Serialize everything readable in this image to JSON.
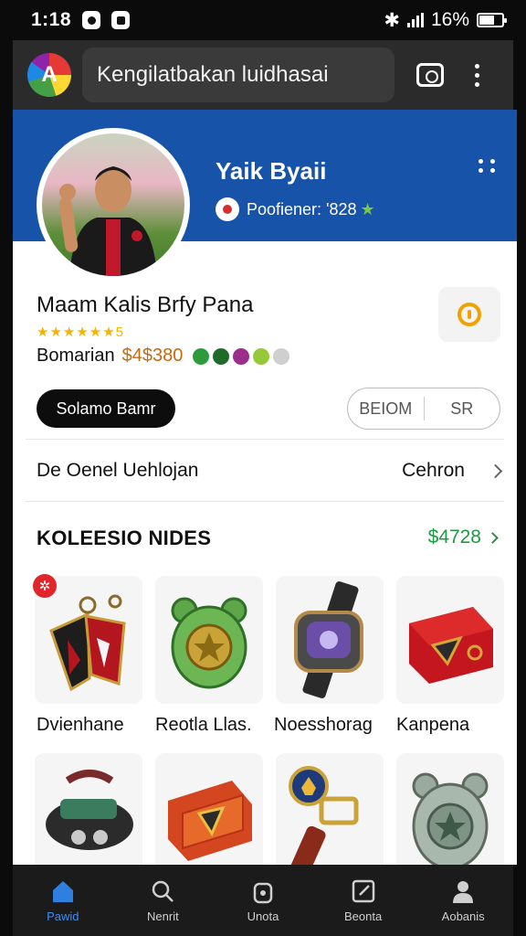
{
  "status_bar": {
    "time": "1:18",
    "battery": "16%"
  },
  "app_bar": {
    "logo_letter": "A",
    "search_text": "Kengilatbakan luidhasai"
  },
  "profile": {
    "name": "Yaik Byaii",
    "badge_text": "Poofiener: '828",
    "badge_star": "★"
  },
  "product": {
    "title": "Maam Kalis Brfy Pana",
    "rating": "★★★★★★5",
    "label": "Bomarian",
    "price": "$4$380",
    "swatch_colors": [
      "#2e9b3a",
      "#1f6b2a",
      "#9b2d8c",
      "#95c93a",
      "#cfcfcf"
    ]
  },
  "actions": {
    "primary_label": "Solamo Bamr",
    "seg_left": "BEIOM",
    "seg_right": "SR"
  },
  "detail_row": {
    "label": "De Oenel Uehlojan",
    "value": "Cehron"
  },
  "collection": {
    "title": "KOLEESIO NIDES",
    "link": "$4728",
    "badge": "✲",
    "items": [
      {
        "label": "Dvienhane"
      },
      {
        "label": "Reotla Llas."
      },
      {
        "label": "Noesshorag"
      },
      {
        "label": "Kanpena"
      },
      {
        "label": ""
      },
      {
        "label": ""
      },
      {
        "label": ""
      },
      {
        "label": ""
      }
    ]
  },
  "bottom_nav": [
    {
      "label": "Pawid",
      "icon": "home-icon",
      "active": true
    },
    {
      "label": "Nenrit",
      "icon": "search-icon",
      "active": false
    },
    {
      "label": "Unota",
      "icon": "lock-icon",
      "active": false
    },
    {
      "label": "Beonta",
      "icon": "edit-icon",
      "active": false
    },
    {
      "label": "Aobanis",
      "icon": "person-icon",
      "active": false
    }
  ]
}
